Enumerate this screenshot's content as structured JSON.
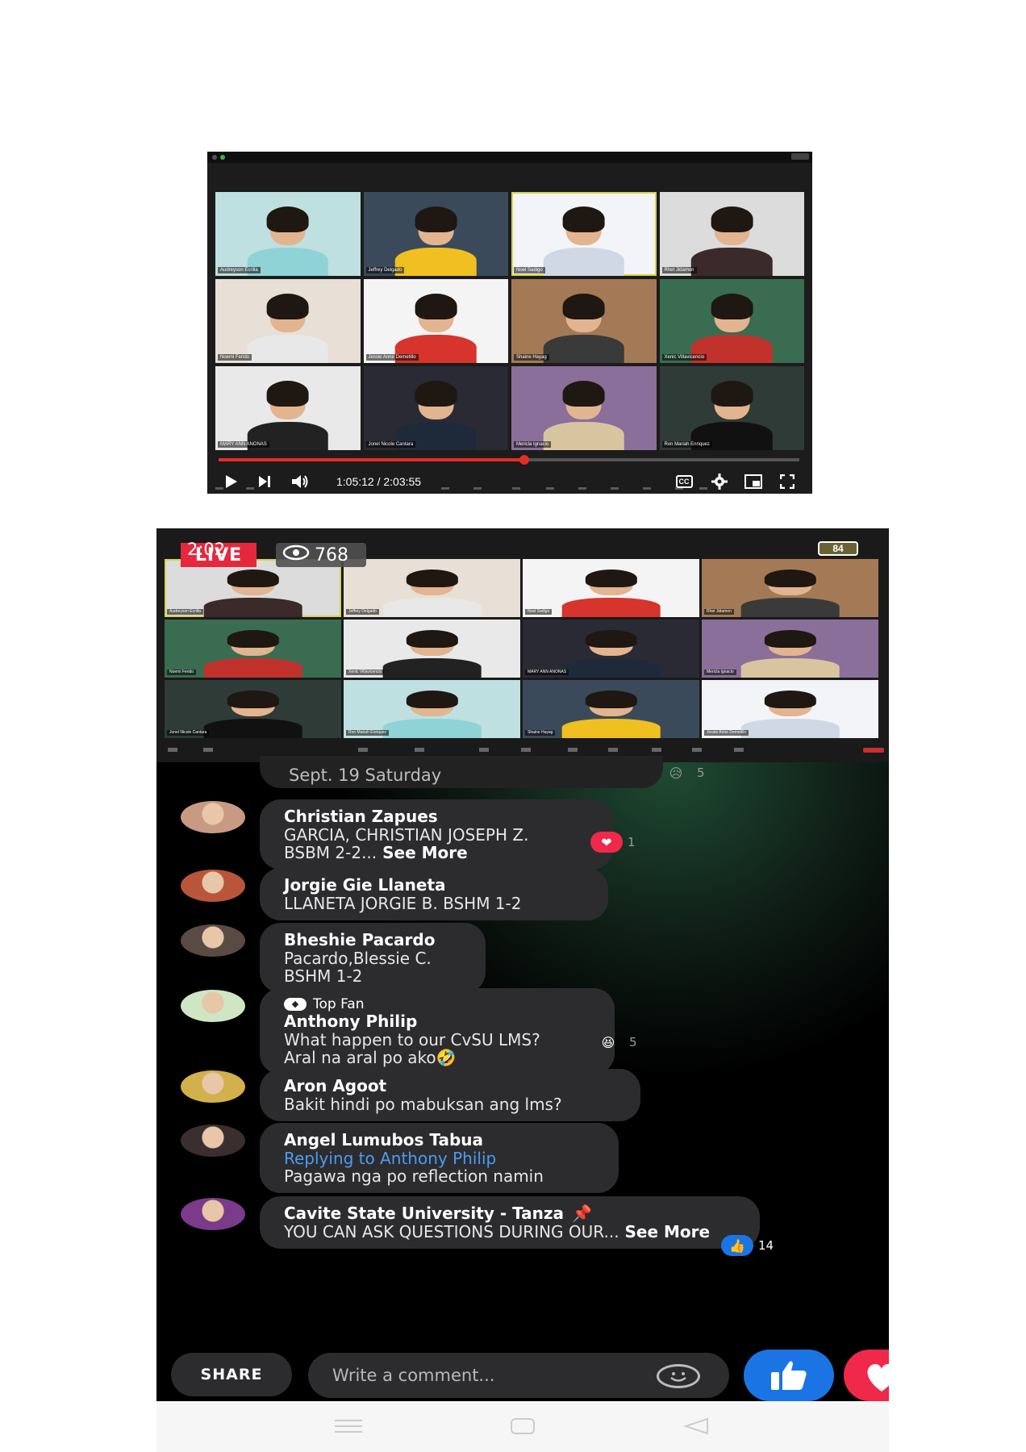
{
  "video_player": {
    "time_current": "1:05:12",
    "time_total": "2:03:55",
    "time_display": "1:05:12 / 2:03:55",
    "progress": 0.526,
    "cc_label": "CC",
    "participants": [
      {
        "name": "Audreyson Ecrilla"
      },
      {
        "name": "Jeffrey Delgado"
      },
      {
        "name": "Noel Sadigo"
      },
      {
        "name": "Rhet Jidamon"
      },
      {
        "name": "Noemi Ferido"
      },
      {
        "name": "Jessie Anne Demetillo"
      },
      {
        "name": "Shaine Hayag"
      },
      {
        "name": "Xenic Villavicencio"
      },
      {
        "name": "MARY ANN ANONAS"
      },
      {
        "name": "Jonel Nicole Cantara"
      },
      {
        "name": "Mericla Ignacio"
      },
      {
        "name": "Ron Mariah Enriquez"
      }
    ]
  },
  "live_stream": {
    "status_time": "2:02",
    "live_label": "LIVE",
    "viewers": "768",
    "battery": "84",
    "participants": [
      {
        "name": "Audreyson Ecrilla"
      },
      {
        "name": "Jeffrey Delgado"
      },
      {
        "name": "Noel Sadigo"
      },
      {
        "name": "Rhet Jidamon"
      },
      {
        "name": "Noemi Ferido"
      },
      {
        "name": "Xenic Villavicencio"
      },
      {
        "name": "MARY ANN ANONAS"
      },
      {
        "name": "Mericla Ignacio"
      },
      {
        "name": "Jonel Nicole Cantara"
      },
      {
        "name": "Ron Mariah Enriquez"
      },
      {
        "name": "Shaine Hayag"
      },
      {
        "name": "Jessie Anne Demetillo"
      }
    ]
  },
  "comments": {
    "date_group": "Sept. 19 Saturday",
    "date_group_reaction_count": "5",
    "items": [
      {
        "name": "Christian Zapues",
        "line1": "GARCIA, CHRISTIAN JOSEPH Z.",
        "line2": "BSBM 2-2...",
        "see_more": "See More",
        "reaction": "heart",
        "reaction_count": "1"
      },
      {
        "name": "Jorgie Gie Llaneta",
        "line1": "LLANETA JORGIE B. BSHM 1-2"
      },
      {
        "name": "Bheshie Pacardo",
        "line1": "Pacardo,Blessie C.",
        "line2": "BSHM 1-2"
      },
      {
        "badge": "Top Fan",
        "name": "Anthony Philip",
        "line1": "What happen to our CvSU LMS?",
        "line2": "Aral na aral po ako🤣",
        "reaction": "haha",
        "reaction_count": "5"
      },
      {
        "name": "Aron Agoot",
        "line1": "Bakit hindi po mabuksan ang lms?"
      },
      {
        "name": "Angel Lumubos Tabua",
        "reply_to": "Replying to Anthony Philip",
        "line1": "Pagawa nga po reflection namin"
      },
      {
        "name": "Cavite State University - Tanza",
        "pinned": true,
        "line1": "YOU CAN ASK QUESTIONS DURING OUR...",
        "see_more": "See More",
        "reaction": "like",
        "reaction_count": "14"
      }
    ]
  },
  "bottom_bar": {
    "share_label": "SHARE",
    "comment_placeholder": "Write a comment..."
  },
  "colors": {
    "live_red": "#e6283e",
    "facebook_blue": "#1b74e4",
    "reply_blue": "#4a9cf5",
    "progress_red": "#e52d27",
    "love_red": "#f02849"
  }
}
